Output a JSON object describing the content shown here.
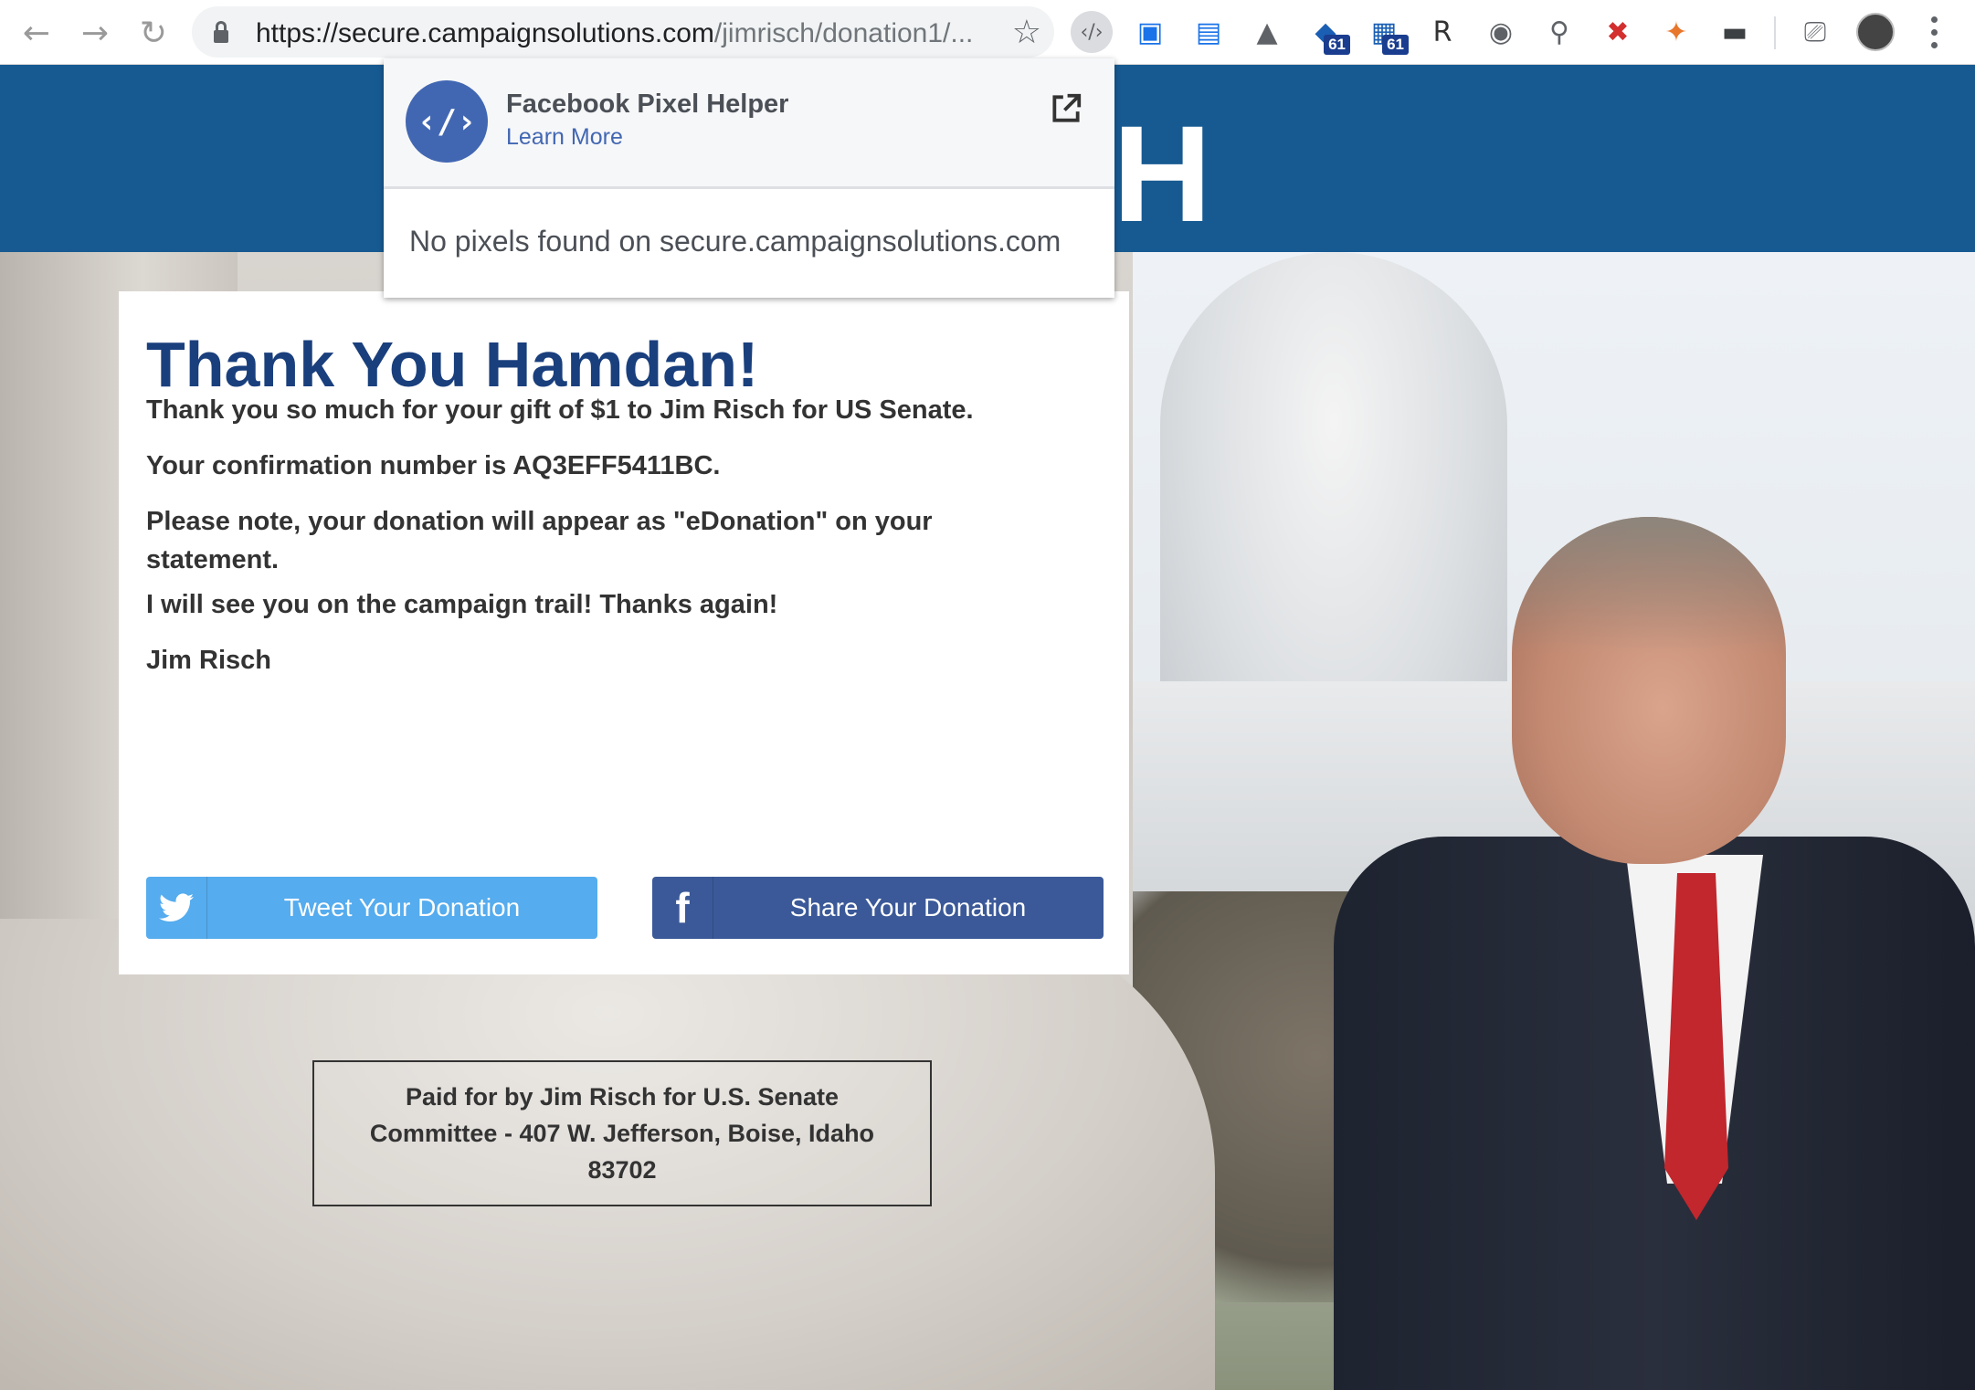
{
  "browser": {
    "url_host": "https://secure.campaignsolutions.com",
    "url_path": "/jimrisch/donation1/...",
    "extensions": [
      {
        "name": "pixel-helper-icon",
        "glyph": "‹/›",
        "badge": ""
      },
      {
        "name": "window-icon",
        "glyph": "▣",
        "badge": ""
      },
      {
        "name": "screens-icon",
        "glyph": "▤",
        "badge": ""
      },
      {
        "name": "drive-icon",
        "glyph": "▲",
        "badge": ""
      },
      {
        "name": "tag-icon",
        "glyph": "◆",
        "badge": "61"
      },
      {
        "name": "barcode-icon",
        "glyph": "▦",
        "badge": "61"
      },
      {
        "name": "r-icon",
        "glyph": "R",
        "badge": ""
      },
      {
        "name": "eye-icon",
        "glyph": "◉",
        "badge": ""
      },
      {
        "name": "search-extension-icon",
        "glyph": "⚲",
        "badge": ""
      },
      {
        "name": "blocker-icon",
        "glyph": "✖",
        "badge": ""
      },
      {
        "name": "fox-icon",
        "glyph": "✦",
        "badge": ""
      },
      {
        "name": "folder-icon",
        "glyph": "▬",
        "badge": ""
      }
    ]
  },
  "banner": {
    "logo_fragment": "H"
  },
  "card": {
    "heading": "Thank You Hamdan!",
    "line1": "Thank you so much for your gift of $1 to Jim Risch for US Senate.",
    "line2": "Your confirmation number is AQ3EFF5411BC.",
    "line3": "Please note, your donation will appear as \"eDonation\" on your statement.",
    "line4": "I will see you on the campaign trail! Thanks again!",
    "signature": "Jim Risch",
    "tweet_label": "Tweet Your Donation",
    "share_label": "Share Your Donation"
  },
  "footer": {
    "paid_for": "Paid for by Jim Risch for U.S. Senate Committee - 407 W. Jefferson, Boise, Idaho 83702"
  },
  "popup": {
    "title": "Facebook Pixel Helper",
    "learn_more": "Learn More",
    "message": "No pixels found on secure.campaignsolutions.com"
  },
  "colors": {
    "banner": "#175a92",
    "heading": "#1a3f7d",
    "twitter": "#55acee",
    "facebook": "#3b5998"
  }
}
